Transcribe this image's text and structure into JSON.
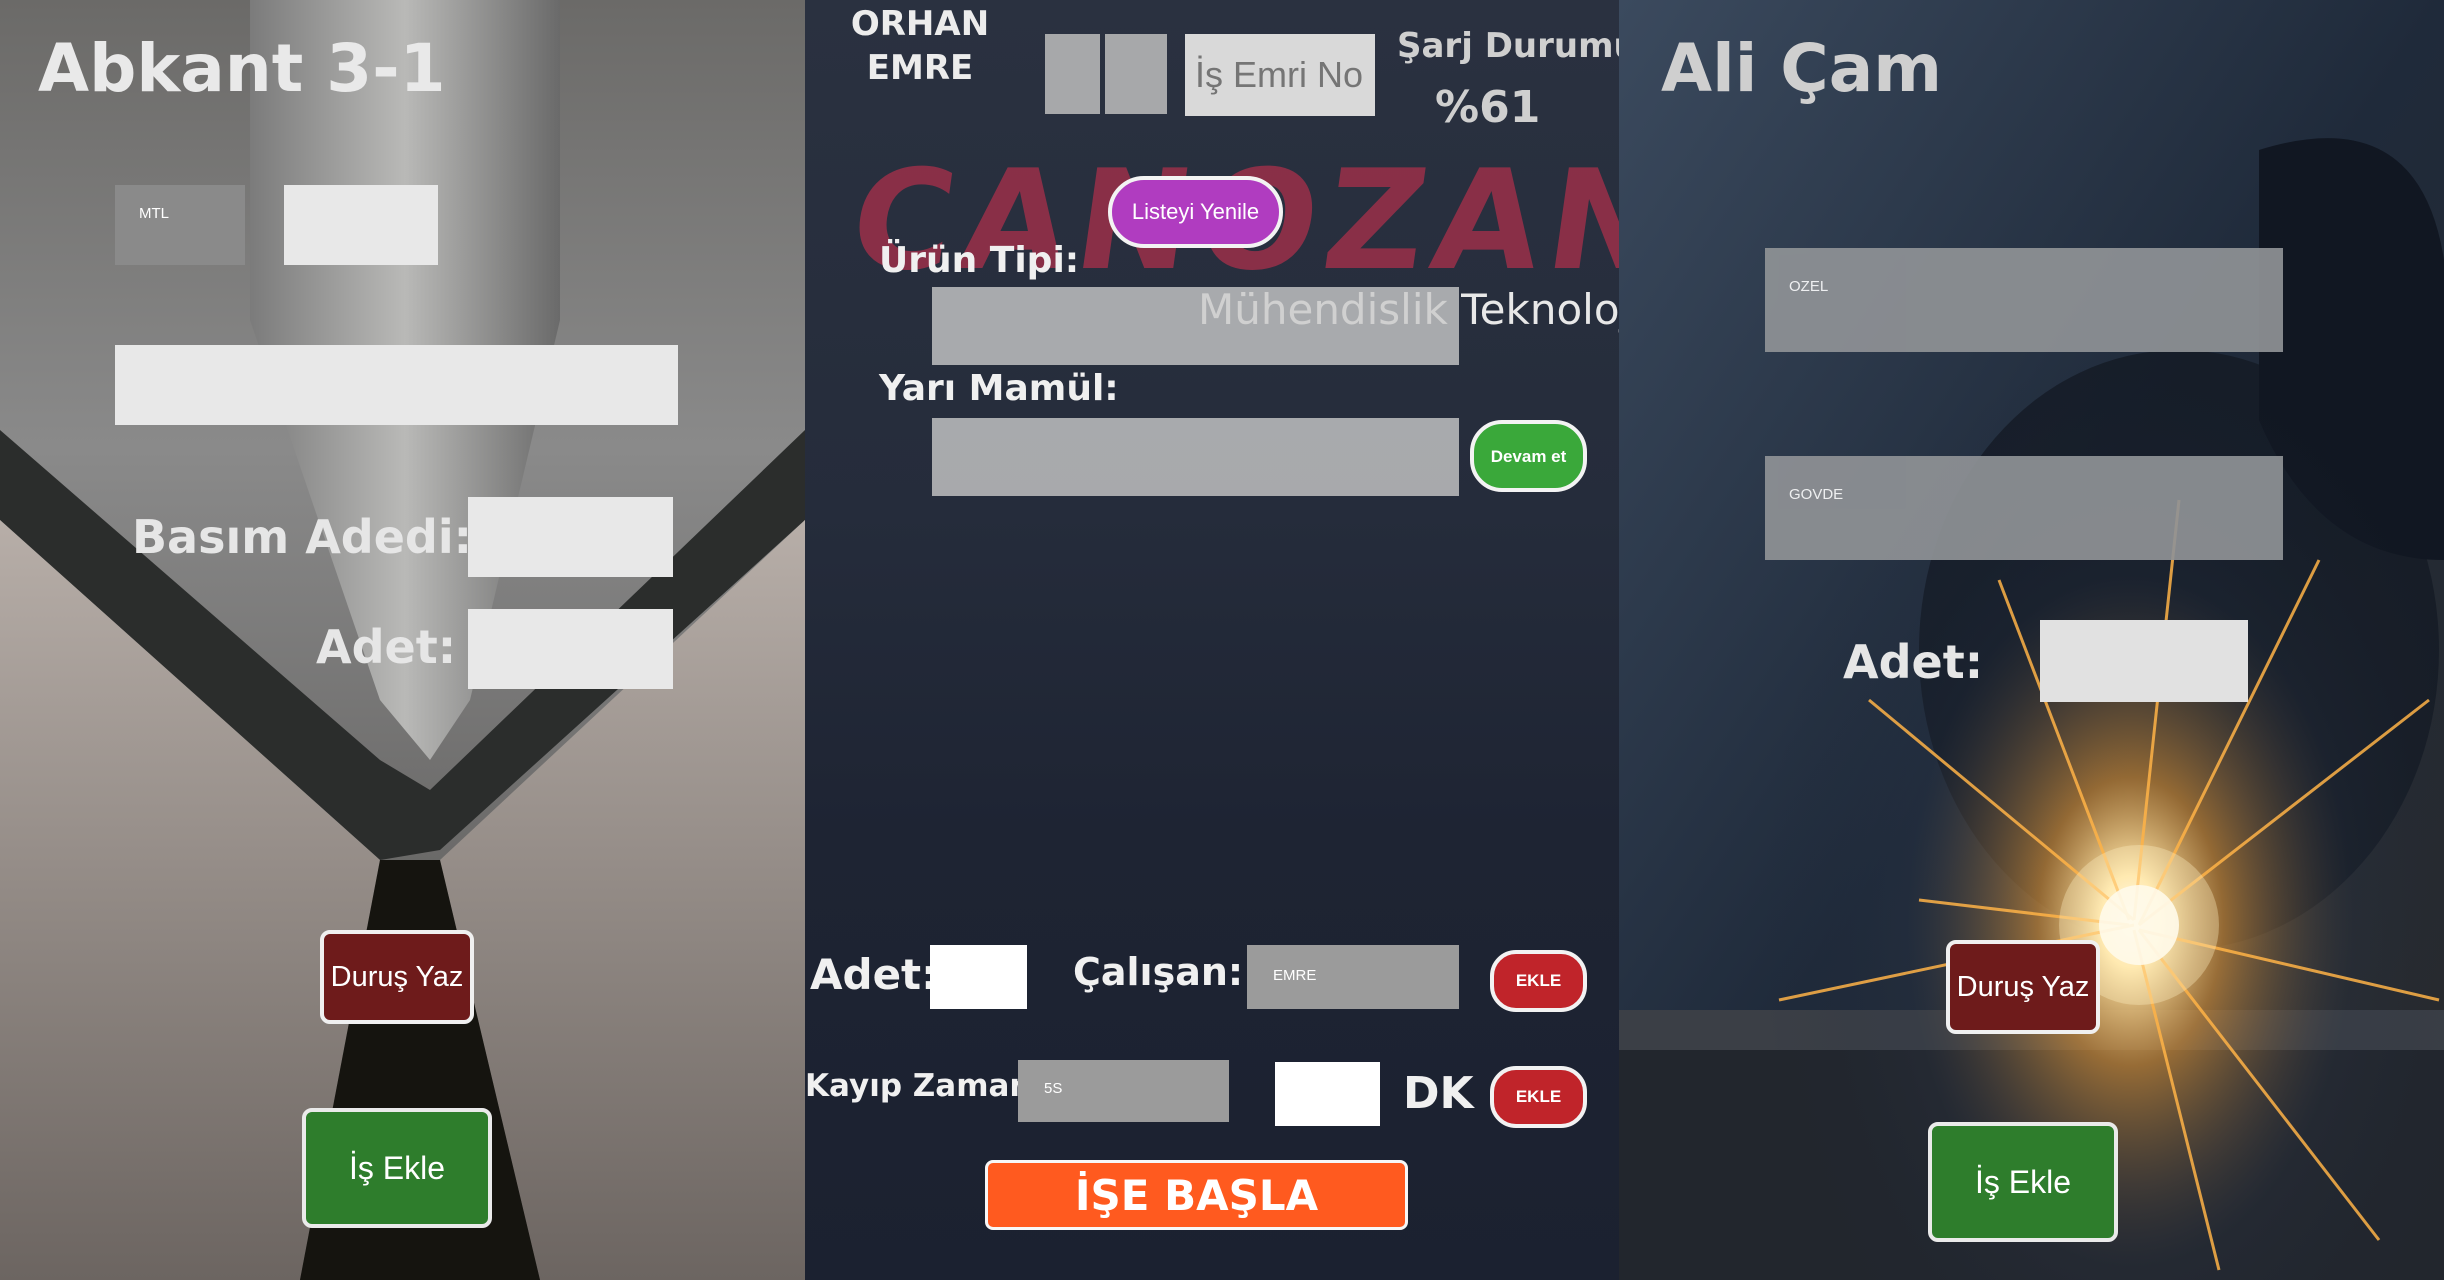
{
  "left": {
    "title": "Abkant 3-1",
    "mtl_label": "MTL",
    "basim_label": "Basım Adedi:",
    "adet_label": "Adet:",
    "durus_button": "Duruş Yaz",
    "is_ekle_button": "İş Ekle"
  },
  "center": {
    "user_name_line1": "ORHAN",
    "user_name_line2": "EMRE",
    "is_emri_placeholder": "İş Emri No",
    "battery_label": "Şarj Durumu",
    "battery_value": "%61",
    "logo_text": "CANOZAN",
    "logo_sub": "Mühendislik Teknoloji",
    "refresh_button": "Listeyi Yenile",
    "urun_tipi_label": "Ürün Tipi:",
    "yari_mamul_label": "Yarı Mamül:",
    "devam_button": "Devam et",
    "adet_label": "Adet:",
    "calisan_label": "Çalışan:",
    "calisan_value": "EMRE",
    "ekle_button_1": "EKLE",
    "kayip_label": "Kayıp Zaman:",
    "kayip_value": "5S",
    "dk_label": "DK",
    "ekle_button_2": "EKLE",
    "start_button": "İŞE BAŞLA"
  },
  "right": {
    "title": "Ali Çam",
    "ozel_label": "OZEL",
    "govde_label": "GOVDE",
    "adet_label": "Adet:",
    "durus_button": "Duruş Yaz",
    "is_ekle_button": "İş Ekle"
  },
  "colors": {
    "stop_button": "#6e1b1b",
    "add_button": "#2e7d2c",
    "refresh_button": "#b03cc0",
    "devam_button": "#3aa83a",
    "ekle_button": "#c0242a",
    "start_button": "#ff5a1f"
  }
}
